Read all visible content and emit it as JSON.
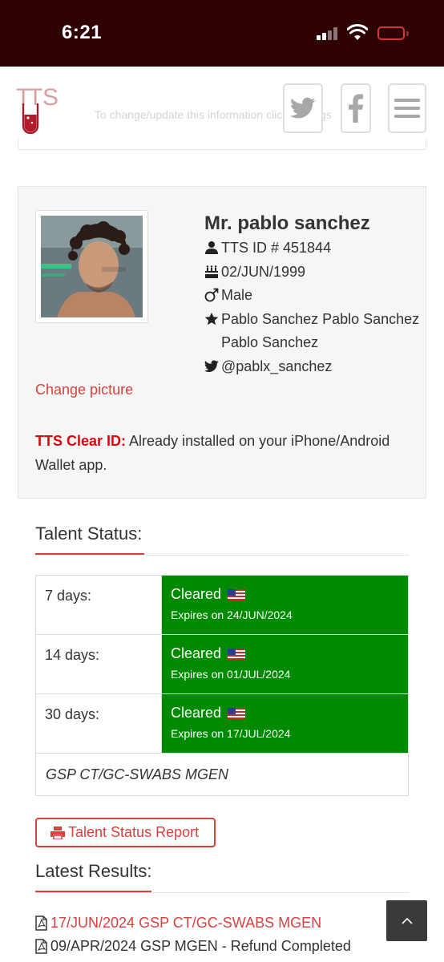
{
  "status_bar": {
    "time": "6:21",
    "icons": [
      "cellular-signal-icon",
      "wifi-icon",
      "battery-icon"
    ],
    "battery_color": "#d03a3a"
  },
  "header": {
    "logo_text": "TTS",
    "notice": "To change/update this information click Settings",
    "buttons": [
      "twitter-icon",
      "facebook-icon",
      "menu-icon"
    ]
  },
  "profile": {
    "name": "Mr. pablo sanchez",
    "tts_id": "TTS ID # 451844",
    "dob": "02/JUN/1999",
    "gender": "Male",
    "display_name": "Pablo Sanchez Pablo Sanchez Pablo Sanchez",
    "twitter": "@pablx_sanchez",
    "change_picture": "Change picture",
    "clear_id_label": "TTS Clear ID:",
    "clear_id_text": " Already installed on your iPhone/Android Wallet app."
  },
  "talent_status": {
    "title": "Talent Status:",
    "rows": [
      {
        "period": "7 days:",
        "status": "Cleared",
        "expires": "Expires on 24/JUN/2024"
      },
      {
        "period": "14 days:",
        "status": "Cleared",
        "expires": "Expires on 01/JUL/2024"
      },
      {
        "period": "30 days:",
        "status": "Cleared",
        "expires": "Expires on 17/JUL/2024"
      }
    ],
    "note": "GSP CT/GC-SWABS MGEN",
    "cleared_color": "#008a00"
  },
  "report_button": "Talent Status Report",
  "latest_results": {
    "title": "Latest Results:",
    "items": [
      {
        "text": "17/JUN/2024 GSP CT/GC-SWABS MGEN",
        "link": true
      },
      {
        "text": "09/APR/2024 GSP MGEN - Refund Completed",
        "link": false
      }
    ]
  },
  "colors": {
    "accent": "#d9413e",
    "status_bar_bg": "#2e0102",
    "clear_id_red": "#e1000f"
  }
}
